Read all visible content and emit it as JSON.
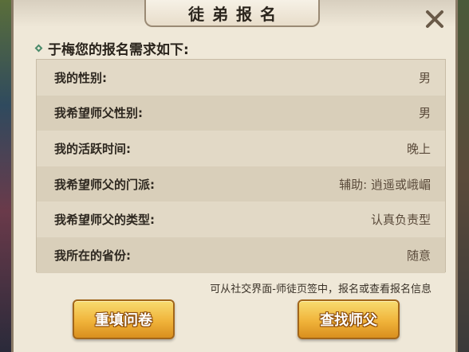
{
  "dialog": {
    "title": "徒弟报名",
    "subheading": "于梅您的报名需求如下:",
    "rows": [
      {
        "label": "我的性别:",
        "value": "男"
      },
      {
        "label": "我希望师父性别:",
        "value": "男"
      },
      {
        "label": "我的活跃时间:",
        "value": "晚上"
      },
      {
        "label": "我希望师父的门派:",
        "value": "辅助: 逍遥或峨嵋"
      },
      {
        "label": "我希望师父的类型:",
        "value": "认真负责型"
      },
      {
        "label": "我所在的省份:",
        "value": "随意"
      }
    ],
    "hint": "可从社交界面-师徒页签中，报名或查看报名信息",
    "buttons": {
      "refill": "重填问卷",
      "find_master": "查找师父"
    }
  },
  "colors": {
    "panel_bg": "#efe8d8",
    "button_gold": "#f0b33a",
    "close_icon": "#6a5a48"
  }
}
